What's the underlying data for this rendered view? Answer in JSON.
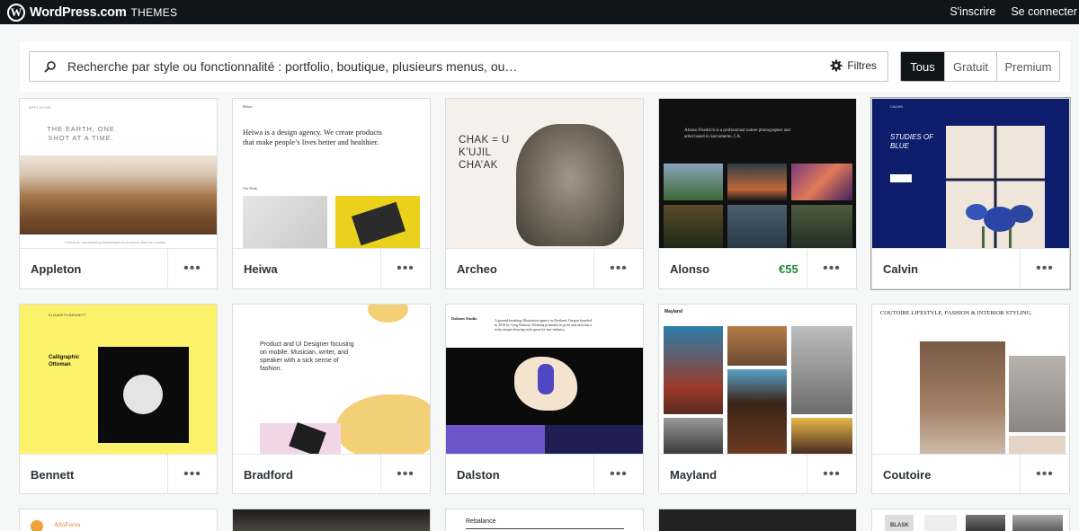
{
  "topbar": {
    "logo_glyph": "W",
    "brand": "WordPress.com",
    "section": "THEMES",
    "signup": "S'inscrire",
    "login": "Se connecter"
  },
  "search": {
    "placeholder": "Recherche par style ou fonctionnalité : portfolio, boutique, plusieurs menus, ou…",
    "filters_label": "Filtres"
  },
  "tiers": [
    {
      "label": "Tous",
      "active": true
    },
    {
      "label": "Gratuit",
      "active": false
    },
    {
      "label": "Premium",
      "active": false
    }
  ],
  "more_label": "•••",
  "themes": [
    {
      "name": "Appleton"
    },
    {
      "name": "Heiwa"
    },
    {
      "name": "Archeo"
    },
    {
      "name": "Alonso",
      "price": "€55"
    },
    {
      "name": "Calvin"
    },
    {
      "name": "Bennett"
    },
    {
      "name": "Bradford"
    },
    {
      "name": "Dalston"
    },
    {
      "name": "Mayland"
    },
    {
      "name": "Coutoire"
    }
  ],
  "previews": {
    "appleton": {
      "header": "APPLETON",
      "headline": "THE EARTH, ONE SHOT AT A TIME.",
      "footer": "I focus on representing landscapes and scenes that are usually"
    },
    "heiwa": {
      "logo": "Heiwa",
      "headline": "Heiwa is a design agency. We create products that make people’s lives better and healthier.",
      "section": "Our Work"
    },
    "archeo": {
      "headline": "CHAK = U K’UJIL CHA’AK"
    },
    "alonso": {
      "intro": "Alonso Friedrich is a professional nature photographer and artist based in Sacramento, CA."
    },
    "calvin": {
      "header": "CALVIN",
      "headline": "STUDIES OF BLUE"
    },
    "bennett": {
      "header": "ELIZABETH BENNETT",
      "headline": "Calligraphic Ottoman"
    },
    "bradford": {
      "headline": "Product and UI Designer focusing on mobile. Musician, writer, and speaker with a sick sense of fashion."
    },
    "dalston": {
      "logo": "Dalston Studio",
      "intro": "A ground-breaking Illustration agency in Portland, Oregon founded in 2010 by Greg Dalston. Working primarily in print and each has a truly unique drawing style great for any industry."
    },
    "mayland": {
      "logo": "Mayland"
    },
    "coutoire": {
      "headline": "COUTOIRE LIFESTYLE, FASHION & INTERIOR STYLING."
    }
  },
  "partial_row": {
    "altofocus": "AltoFocus",
    "rebalance": "Rebalance",
    "blask": "BLASK"
  },
  "colors": {
    "topbar_bg": "#101517",
    "active_tier_bg": "#101517",
    "price_green": "#1e8b3a"
  }
}
